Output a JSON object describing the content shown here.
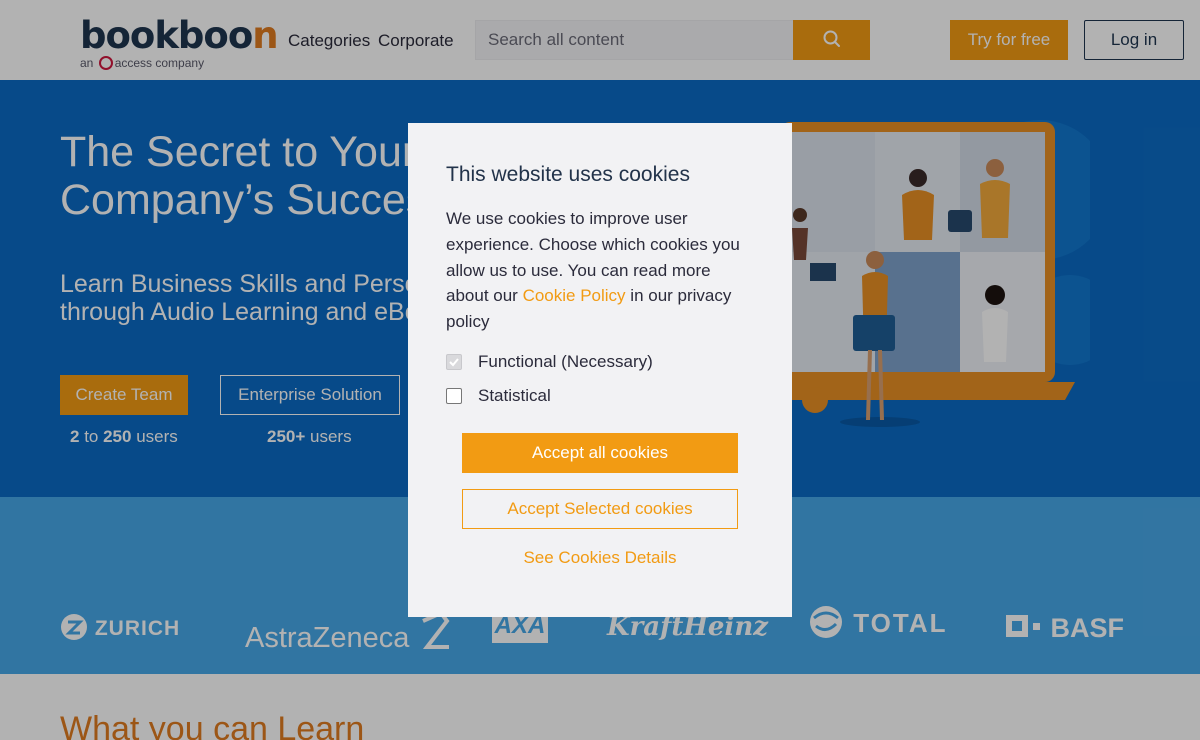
{
  "header": {
    "logo_text_main": "bookboo",
    "logo_text_accent": "n",
    "logo_sub_prefix": "an",
    "logo_sub_suffix": "access company",
    "nav": [
      "Categories",
      "Corporate"
    ],
    "search_placeholder": "Search all content",
    "try_label": "Try for free",
    "login_label": "Log in"
  },
  "hero": {
    "title_line1": "The Secret to Your",
    "title_line2": "Company’s Success",
    "subtitle_line1": "Learn Business Skills and Personal Development",
    "subtitle_line2": "through Audio Learning and eBooks",
    "create_team_label": "Create Team",
    "enterprise_label": "Enterprise Solution",
    "team_users_a": "2",
    "team_users_b": " to ",
    "team_users_c": "250",
    "team_users_d": " users",
    "ent_users_a": "250+",
    "ent_users_b": " users"
  },
  "brands": [
    "ZURICH",
    "AstraZeneca",
    "AXA",
    "KraftHeinz",
    "TOTAL",
    "BASF"
  ],
  "learn_title": "What you can Learn",
  "cookie_modal": {
    "title": "This website uses cookies",
    "text_before_link": "We use cookies to improve user experience. Choose which cookies you allow us to use. You can read more about our ",
    "link_text": "Cookie Policy",
    "text_after_link": " in our privacy policy",
    "options": [
      {
        "label": "Functional (Necessary)",
        "checked": true,
        "disabled": true
      },
      {
        "label": "Statistical",
        "checked": false,
        "disabled": false
      }
    ],
    "accept_all_label": "Accept all cookies",
    "accept_selected_label": "Accept Selected cookies",
    "details_label": "See Cookies Details"
  },
  "colors": {
    "brand_orange": "#f29b13",
    "hero_blue": "#0b6bc4",
    "band_blue": "#47a8e8",
    "navy": "#1f3550"
  }
}
